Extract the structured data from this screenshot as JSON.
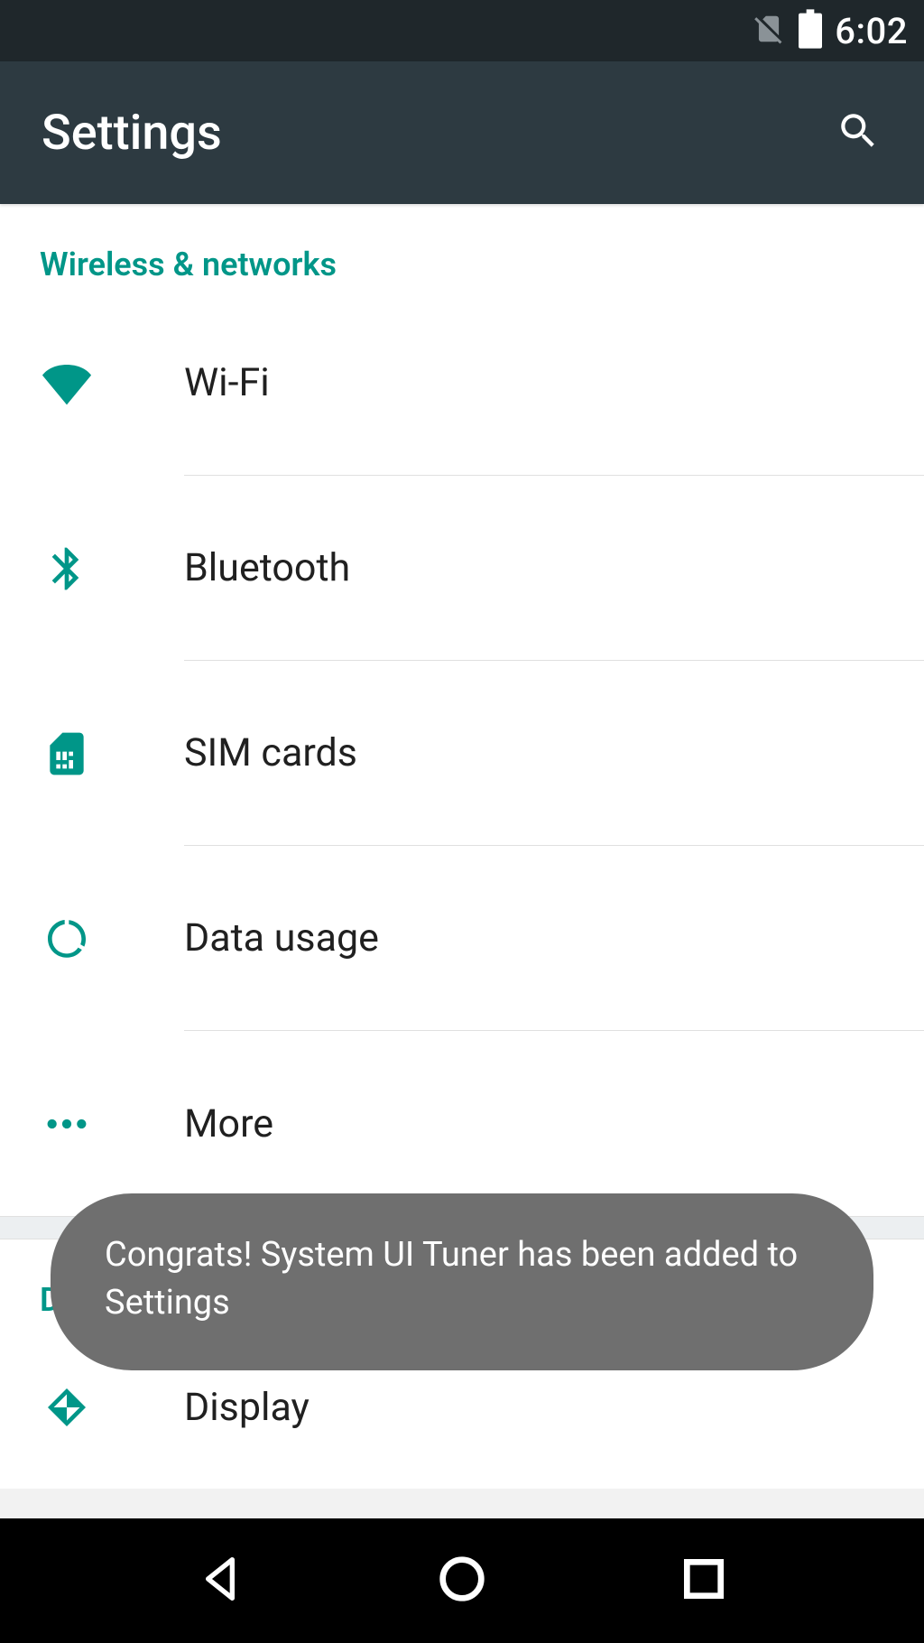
{
  "colors": {
    "accent": "#009688",
    "appbar_bg": "#2d3a41",
    "statusbar_bg": "#1f272b",
    "toast_bg": "#6f6f6f"
  },
  "status": {
    "time": "6:02"
  },
  "header": {
    "title": "Settings"
  },
  "sections": [
    {
      "title": "Wireless & networks",
      "items": [
        {
          "label": "Wi-Fi",
          "icon": "wifi-icon"
        },
        {
          "label": "Bluetooth",
          "icon": "bluetooth-icon"
        },
        {
          "label": "SIM cards",
          "icon": "sim-icon"
        },
        {
          "label": "Data usage",
          "icon": "data-icon"
        },
        {
          "label": "More",
          "icon": "more-icon"
        }
      ]
    },
    {
      "title": "Device",
      "items": [
        {
          "label": "Display",
          "icon": "display-icon"
        }
      ]
    }
  ],
  "toast": {
    "message": "Congrats! System UI Tuner has been added to Settings"
  }
}
